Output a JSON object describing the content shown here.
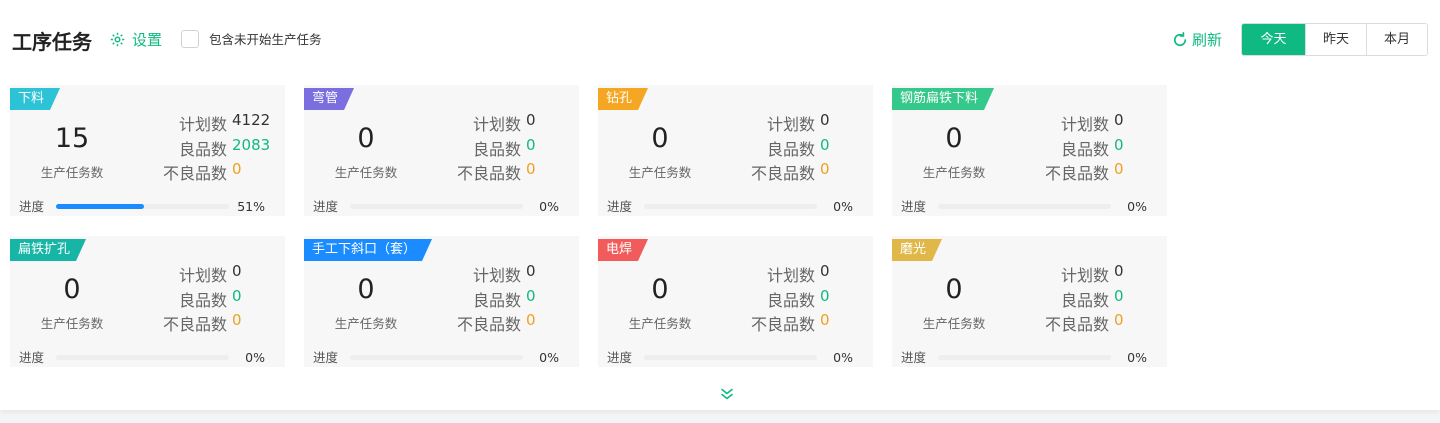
{
  "header": {
    "title": "工序任务",
    "settings_label": "设置",
    "include_label": "包含未开始生产任务",
    "refresh_label": "刷新",
    "ranges": [
      "今天",
      "昨天",
      "本月"
    ],
    "active_range": "今天"
  },
  "labels": {
    "planned": "计划数",
    "good": "良品数",
    "defect": "不良品数",
    "task_count": "生产任务数",
    "progress": "进度"
  },
  "colors": {
    "accent": "#10b981",
    "progress": "#1a8cff",
    "defect": "#f0a020"
  },
  "cards": [
    {
      "name": "下料",
      "color": "#2dc3d6",
      "tasks": "15",
      "planned": "4122",
      "good": "2083",
      "defect": "0",
      "progress": "51%",
      "progress_value": 0.51
    },
    {
      "name": "弯管",
      "color": "#7b6fe0",
      "tasks": "0",
      "planned": "0",
      "good": "0",
      "defect": "0",
      "progress": "0%",
      "progress_value": 0
    },
    {
      "name": "钻孔",
      "color": "#f5a623",
      "tasks": "0",
      "planned": "0",
      "good": "0",
      "defect": "0",
      "progress": "0%",
      "progress_value": 0
    },
    {
      "name": "钢筋扁铁下料",
      "color": "#34c98a",
      "tasks": "0",
      "planned": "0",
      "good": "0",
      "defect": "0",
      "progress": "0%",
      "progress_value": 0
    },
    {
      "name": "扁铁扩孔",
      "color": "#16b5a5",
      "tasks": "0",
      "planned": "0",
      "good": "0",
      "defect": "0",
      "progress": "0%",
      "progress_value": 0
    },
    {
      "name": "手工下斜口（套）",
      "color": "#1a8cff",
      "tasks": "0",
      "planned": "0",
      "good": "0",
      "defect": "0",
      "progress": "0%",
      "progress_value": 0
    },
    {
      "name": "电焊",
      "color": "#f25b5b",
      "tasks": "0",
      "planned": "0",
      "good": "0",
      "defect": "0",
      "progress": "0%",
      "progress_value": 0
    },
    {
      "name": "磨光",
      "color": "#e0b84a",
      "tasks": "0",
      "planned": "0",
      "good": "0",
      "defect": "0",
      "progress": "0%",
      "progress_value": 0
    }
  ]
}
